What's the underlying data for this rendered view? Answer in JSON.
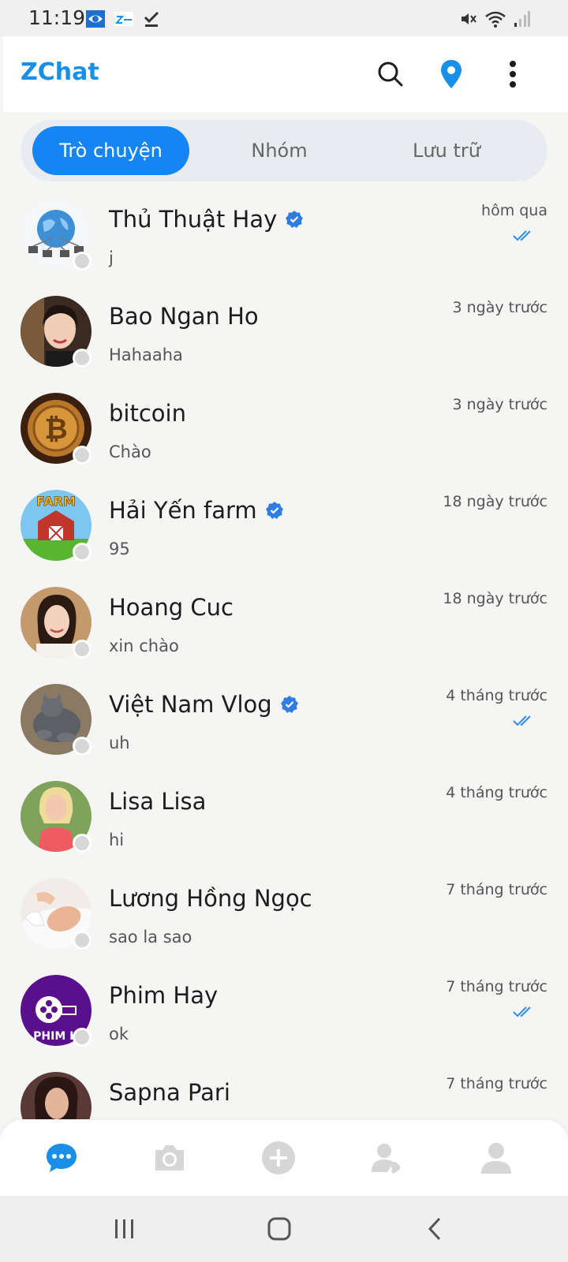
{
  "status_bar": {
    "time": "11:19",
    "left_icons": [
      "eye-app-icon",
      "zchat-notification-icon",
      "download-done-icon"
    ],
    "right_icons": [
      "mute-icon",
      "wifi-icon",
      "signal-icon"
    ]
  },
  "header": {
    "title": "ZChat",
    "actions": [
      "search-icon",
      "location-pin-icon",
      "more-vertical-icon"
    ]
  },
  "tabs": [
    {
      "label": "Trò chuyện",
      "active": true
    },
    {
      "label": "Nhóm",
      "active": false
    },
    {
      "label": "Lưu trữ",
      "active": false
    }
  ],
  "chats": [
    {
      "name": "Thủ Thuật Hay",
      "preview": "j",
      "time": "hôm qua",
      "verified": true,
      "read": true
    },
    {
      "name": "Bao Ngan Ho",
      "preview": "Hahaaha",
      "time": "3 ngày trước",
      "verified": false,
      "read": false
    },
    {
      "name": "bitcoin",
      "preview": "Chào",
      "time": "3 ngày trước",
      "verified": false,
      "read": false
    },
    {
      "name": "Hải Yến farm",
      "preview": "95",
      "time": "18 ngày trước",
      "verified": true,
      "read": false
    },
    {
      "name": "Hoang Cuc",
      "preview": "xin chào",
      "time": "18 ngày trước",
      "verified": false,
      "read": false
    },
    {
      "name": "Việt Nam Vlog",
      "preview": "uh",
      "time": "4 tháng trước",
      "verified": true,
      "read": true
    },
    {
      "name": "Lisa Lisa",
      "preview": "hi",
      "time": "4 tháng trước",
      "verified": false,
      "read": false
    },
    {
      "name": "Lương Hồng Ngọc",
      "preview": "sao la sao",
      "time": "7 tháng trước",
      "verified": false,
      "read": false
    },
    {
      "name": "Phim Hay",
      "preview": "ok",
      "time": "7 tháng trước",
      "verified": false,
      "read": true
    },
    {
      "name": "Sapna Pari",
      "preview": "",
      "time": "7 tháng trước",
      "verified": false,
      "read": false
    }
  ],
  "avatar_labels": {
    "farm": "FARM",
    "phim": "PHIM H"
  },
  "bottom_nav": [
    "chat-bubble-icon",
    "camera-icon",
    "add-circle-icon",
    "contacts-icon",
    "profile-icon"
  ],
  "colors": {
    "accent": "#1585f5",
    "brand": "#1a8fe8",
    "verified": "#2f7de1",
    "nav_inactive": "#d6d6d6"
  }
}
